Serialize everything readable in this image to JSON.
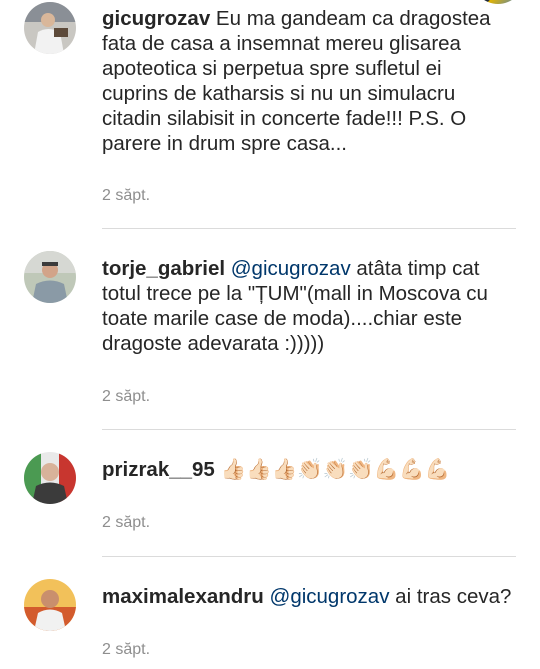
{
  "comments": [
    {
      "username": "gicugrozav",
      "mention": "",
      "body": "Eu ma gandeam ca dragostea fata de casa a insemnat mereu glisarea apoteotica si perpetua spre sufletul ei cuprins de katharsis si nu un simulacru citadin silabisit in concerte fade!!! P.S. O parere in drum spre casa...",
      "time": "2 săpt."
    },
    {
      "username": "torje_gabriel",
      "mention": "@gicugrozav",
      "body": "atâta timp cat totul trece pe la \"ȚUM\"(mall in Moscova cu toate marile case de moda)....chiar este dragoste adevarata :)))))",
      "time": "2 săpt."
    },
    {
      "username": "prizrak__95",
      "mention": "",
      "body": "👍🏻👍🏻👍🏻👏🏻👏🏻👏🏻💪🏻💪🏻💪🏻",
      "time": "2 săpt."
    },
    {
      "username": "maximalexandru",
      "mention": "@gicugrozav",
      "body": "ai tras ceva?",
      "time": "2 săpt."
    }
  ]
}
